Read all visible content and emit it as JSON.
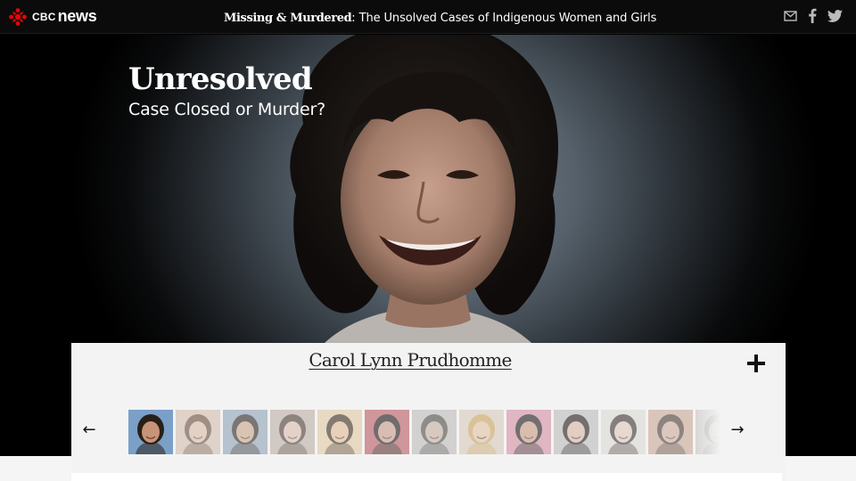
{
  "header": {
    "brand_prefix": "CBC",
    "brand_main": "news",
    "series_bold": "Missing & Murdered",
    "series_rest": ": The Unsolved Cases of Indigenous Women and Girls",
    "share_icons": [
      "email-icon",
      "facebook-icon",
      "twitter-icon"
    ]
  },
  "hero": {
    "title": "Unresolved",
    "subtitle": "Case Closed or Murder?"
  },
  "panel": {
    "case_name": "Carol Lynn Prudhomme",
    "expand_icon": "plus-icon",
    "prev_arrow": "←",
    "next_arrow": "→"
  },
  "thumbnails": [
    {
      "skin": "#c89478",
      "hair": "#2a1f18",
      "bg": "#7aa0c8",
      "opacity": 1
    },
    {
      "skin": "#d9b7a0",
      "hair": "#5b3d2a",
      "bg": "#cdb8a8",
      "opacity": 0.55
    },
    {
      "skin": "#c9a48a",
      "hair": "#2b2420",
      "bg": "#8fa3b5",
      "opacity": 0.6
    },
    {
      "skin": "#d8b8a8",
      "hair": "#3a2a22",
      "bg": "#b7a79e",
      "opacity": 0.55
    },
    {
      "skin": "#e1b994",
      "hair": "#3a2a1c",
      "bg": "#e2c9a4",
      "opacity": 0.6
    },
    {
      "skin": "#c79a88",
      "hair": "#1c1414",
      "bg": "#b85a62",
      "opacity": 0.6
    },
    {
      "skin": "#c0a898",
      "hair": "#3c3834",
      "bg": "#b8b6b2",
      "opacity": 0.55
    },
    {
      "skin": "#e2c2a2",
      "hair": "#c9a25a",
      "bg": "#d8c8bc",
      "opacity": 0.6
    },
    {
      "skin": "#c89c84",
      "hair": "#1e1818",
      "bg": "#d58fa2",
      "opacity": 0.6
    },
    {
      "skin": "#d7b6a4",
      "hair": "#1d1816",
      "bg": "#bcbcbc",
      "opacity": 0.6
    },
    {
      "skin": "#dcc4b4",
      "hair": "#2a2220",
      "bg": "#d9d6cf",
      "opacity": 0.55
    },
    {
      "skin": "#caa494",
      "hair": "#3a2a24",
      "bg": "#c7a08c",
      "opacity": 0.55
    },
    {
      "skin": "#b8b0aa",
      "hair": "#5a5450",
      "bg": "#a8a4a0",
      "opacity": 0.35
    }
  ],
  "colors": {
    "brand_red": "#e60505",
    "topbar_bg": "#0b0b0b",
    "panel_bg": "#f3f3f3"
  }
}
